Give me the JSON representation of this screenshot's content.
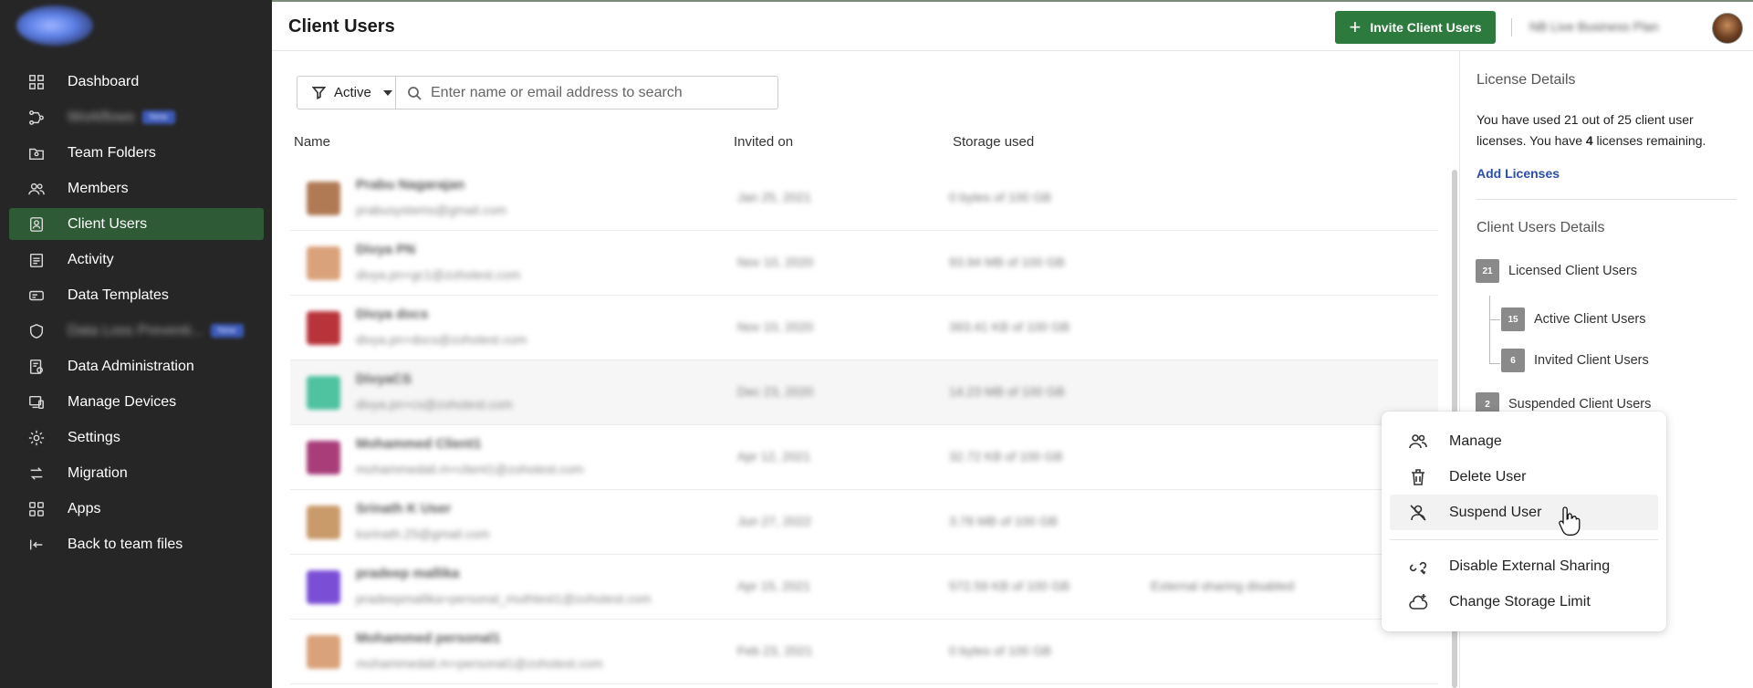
{
  "sidebar": {
    "items": [
      {
        "label": "Dashboard",
        "icon": "dashboard-icon",
        "active": false,
        "blurred": false
      },
      {
        "label": "Workflows",
        "icon": "workflow-icon",
        "active": false,
        "blurred": true,
        "badge": "New"
      },
      {
        "label": "Team Folders",
        "icon": "team-folder-icon",
        "active": false,
        "blurred": false
      },
      {
        "label": "Members",
        "icon": "members-icon",
        "active": false,
        "blurred": false
      },
      {
        "label": "Client Users",
        "icon": "client-user-icon",
        "active": true,
        "blurred": false
      },
      {
        "label": "Activity",
        "icon": "activity-icon",
        "active": false,
        "blurred": false
      },
      {
        "label": "Data Templates",
        "icon": "data-template-icon",
        "active": false,
        "blurred": false
      },
      {
        "label": "Data Loss Preventi...",
        "icon": "shield-icon",
        "active": false,
        "blurred": true,
        "badge": "New"
      },
      {
        "label": "Data Administration",
        "icon": "data-admin-icon",
        "active": false,
        "blurred": false
      },
      {
        "label": "Manage Devices",
        "icon": "devices-icon",
        "active": false,
        "blurred": false
      },
      {
        "label": "Settings",
        "icon": "gear-icon",
        "active": false,
        "blurred": false
      },
      {
        "label": "Migration",
        "icon": "migration-icon",
        "active": false,
        "blurred": false
      },
      {
        "label": "Apps",
        "icon": "apps-icon",
        "active": false,
        "blurred": false
      },
      {
        "label": "Back to team files",
        "icon": "back-icon",
        "active": false,
        "blurred": false
      }
    ]
  },
  "header": {
    "title": "Client Users",
    "invite_label": "Invite Client Users",
    "plan": "NB Live Business Plan"
  },
  "filter": {
    "status": "Active",
    "search_placeholder": "Enter name or email address to search"
  },
  "table": {
    "columns": {
      "name": "Name",
      "invited": "Invited on",
      "storage": "Storage used"
    },
    "rows": [
      {
        "name": "Prabu Nagarajan",
        "email": "prabusystems@gmail.com",
        "invited": "Jan 25, 2021",
        "storage": "0 bytes of 100 GB",
        "extra": "",
        "avatar_color": "#b07a55"
      },
      {
        "name": "Divya PN",
        "email": "divya.pn+gc1@zohotest.com",
        "invited": "Nov 10, 2020",
        "storage": "93.94 MB of 100 GB",
        "extra": "",
        "avatar_color": "#d9a27a"
      },
      {
        "name": "Divya docs",
        "email": "divya.pn+docs@zohotest.com",
        "invited": "Nov 10, 2020",
        "storage": "393.41 KB of 100 GB",
        "extra": "",
        "avatar_color": "#b8343a"
      },
      {
        "name": "DivyaCS",
        "email": "divya.pn+cs@zohotest.com",
        "invited": "Dec 23, 2020",
        "storage": "14.23 MB of 100 GB",
        "extra": "",
        "avatar_color": "#4fc2a0"
      },
      {
        "name": "Mohammed Client1",
        "email": "mohammedali.m+client1@zohotest.com",
        "invited": "Apr 12, 2021",
        "storage": "32.72 KB of 100 GB",
        "extra": "",
        "avatar_color": "#a83d7a"
      },
      {
        "name": "Srinath K User",
        "email": "ksrinath.25@gmail.com",
        "invited": "Jun 27, 2022",
        "storage": "3.78 MB of 100 GB",
        "extra": "",
        "avatar_color": "#c99a6a"
      },
      {
        "name": "pradeep mallika",
        "email": "pradeepmallika+personal_muthtest1@zohotest.com",
        "invited": "Apr 15, 2021",
        "storage": "572.59 KB of 100 GB",
        "extra": "External sharing disabled",
        "avatar_color": "#7a4fd6"
      },
      {
        "name": "Mohammed personal1",
        "email": "mohammedali.m+personal1@zohotest.com",
        "invited": "Feb 23, 2021",
        "storage": "0 bytes of 100 GB",
        "extra": "",
        "avatar_color": "#d9a27a"
      }
    ]
  },
  "panel": {
    "license_title": "License Details",
    "license_text_pre": "You have used 21 out of 25 client user licenses. You have ",
    "license_remaining": "4",
    "license_text_post": " licenses remaining.",
    "add_licenses": "Add Licenses",
    "details_title": "Client Users Details",
    "licensed": {
      "count": "21",
      "label": "Licensed Client Users"
    },
    "active": {
      "count": "15",
      "label": "Active Client Users"
    },
    "invited": {
      "count": "6",
      "label": "Invited Client Users"
    },
    "suspended": {
      "count": "2",
      "label": "Suspended Client Users"
    }
  },
  "menu": {
    "manage": "Manage",
    "delete": "Delete User",
    "suspend": "Suspend User",
    "disable_sharing": "Disable External Sharing",
    "storage_limit": "Change Storage Limit"
  },
  "colors": {
    "sidebar_bg": "#262626",
    "active_item": "#2e5a36",
    "primary_button": "#2c7a3e",
    "link": "#2b4fa8"
  }
}
